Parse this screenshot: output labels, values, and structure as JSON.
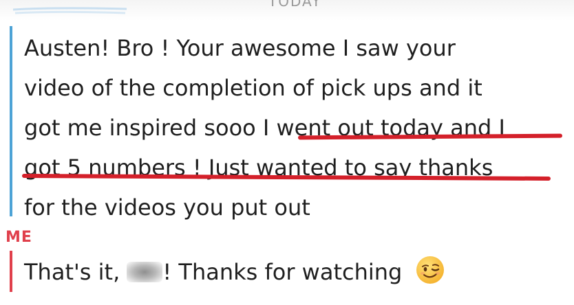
{
  "header": {
    "cut_off_text": "TODAY"
  },
  "friend_message": {
    "line1": "Austen! Bro ! Your awesome I saw your",
    "line2": "video of the completion of pick ups and it",
    "line3_before": "got me inspired sooo ",
    "line3_highlight": "I went out today and I",
    "line4_highlight": "got 5 numbers ! Just wanted to say thanks",
    "line5": "for the videos you put out"
  },
  "me": {
    "sender_label": "ME",
    "message_before": "That's it, ",
    "message_after": "! Thanks for watching",
    "emoji": "winking-face-emoji"
  },
  "colors": {
    "friend_bar": "#4da3d6",
    "me_accent": "#e0404c",
    "underline": "#d4202a"
  }
}
